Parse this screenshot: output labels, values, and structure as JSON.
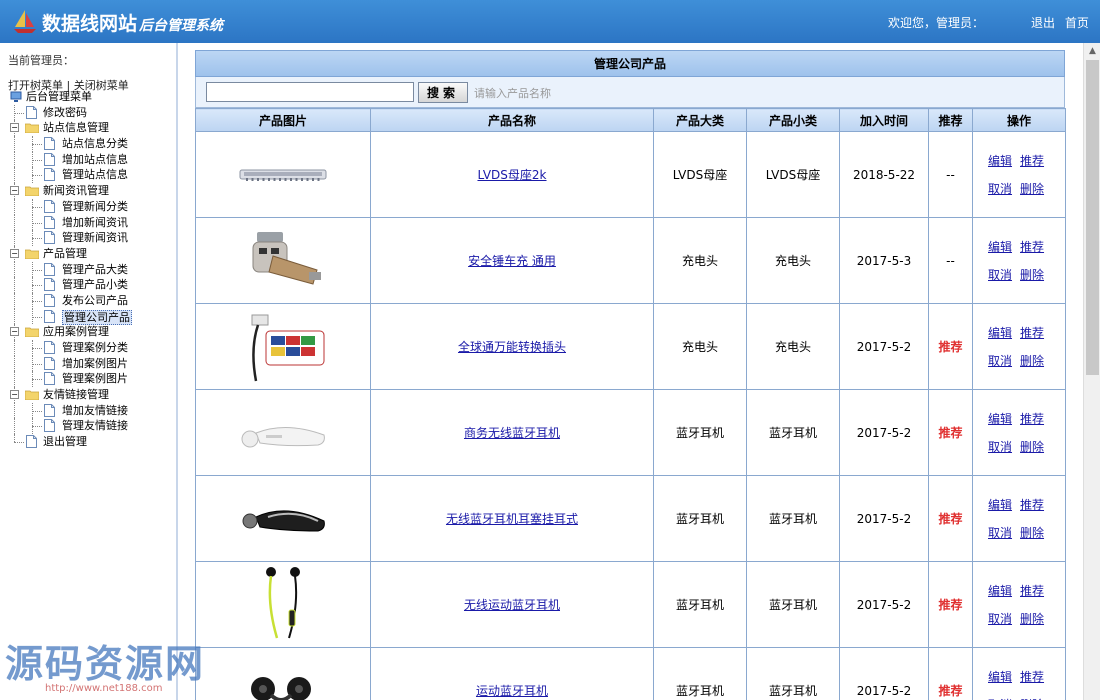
{
  "header": {
    "site_name": "数据线网站",
    "system_name": "后台管理系统",
    "welcome": "欢迎您，管理员：",
    "logout": "退出",
    "home": "首页"
  },
  "sidebar": {
    "current_admin": "当前管理员：",
    "open_tree": "打开树菜单",
    "separator": "|",
    "close_tree": "关闭树菜单",
    "root": "后台管理菜单",
    "change_password": "修改密码",
    "groups": [
      {
        "label": "站点信息管理",
        "items": [
          "站点信息分类",
          "增加站点信息",
          "管理站点信息"
        ]
      },
      {
        "label": "新闻资讯管理",
        "items": [
          "管理新闻分类",
          "增加新闻资讯",
          "管理新闻资讯"
        ]
      },
      {
        "label": "产品管理",
        "items": [
          "管理产品大类",
          "管理产品小类",
          "发布公司产品",
          "管理公司产品"
        ]
      },
      {
        "label": "应用案例管理",
        "items": [
          "管理案例分类",
          "增加案例图片",
          "管理案例图片"
        ]
      },
      {
        "label": "友情链接管理",
        "items": [
          "增加友情链接",
          "管理友情链接"
        ]
      }
    ],
    "logout": "退出管理"
  },
  "main": {
    "title": "管理公司产品",
    "search": {
      "value": "",
      "button": "搜索",
      "hint": "请输入产品名称"
    },
    "columns": [
      "产品图片",
      "产品名称",
      "产品大类",
      "产品小类",
      "加入时间",
      "推荐",
      "操作"
    ],
    "rows": [
      {
        "image": "lvds-connector",
        "name": "LVDS母座2k",
        "category": "LVDS母座",
        "subcategory": "LVDS母座",
        "date": "2018-5-22",
        "recommend": "--",
        "recommended": false
      },
      {
        "image": "car-charger",
        "name": "安全锤车充 通用",
        "category": "充电头",
        "subcategory": "充电头",
        "date": "2017-5-3",
        "recommend": "--",
        "recommended": false
      },
      {
        "image": "travel-adapter",
        "name": "全球通万能转换插头",
        "category": "充电头",
        "subcategory": "充电头",
        "date": "2017-5-2",
        "recommend": "推荐",
        "recommended": true
      },
      {
        "image": "white-headset",
        "name": "商务无线蓝牙耳机",
        "category": "蓝牙耳机",
        "subcategory": "蓝牙耳机",
        "date": "2017-5-2",
        "recommend": "推荐",
        "recommended": true
      },
      {
        "image": "black-headset",
        "name": "无线蓝牙耳机耳塞挂耳式",
        "category": "蓝牙耳机",
        "subcategory": "蓝牙耳机",
        "date": "2017-5-2",
        "recommend": "推荐",
        "recommended": true
      },
      {
        "image": "sport-earphones",
        "name": "无线运动蓝牙耳机",
        "category": "蓝牙耳机",
        "subcategory": "蓝牙耳机",
        "date": "2017-5-2",
        "recommend": "推荐",
        "recommended": true
      },
      {
        "image": "sport-headset",
        "name": "运动蓝牙耳机",
        "category": "蓝牙耳机",
        "subcategory": "蓝牙耳机",
        "date": "2017-5-2",
        "recommend": "推荐",
        "recommended": true
      }
    ],
    "actions": {
      "edit": "编辑",
      "recommend": "推荐",
      "cancel": "取消",
      "delete": "删除"
    }
  },
  "watermark": {
    "text": "源码资源网",
    "url": "http://www.net188.com"
  },
  "colors": {
    "header": "#2c75c4",
    "link": "#1a1aa8",
    "recommend": "#e03030"
  }
}
